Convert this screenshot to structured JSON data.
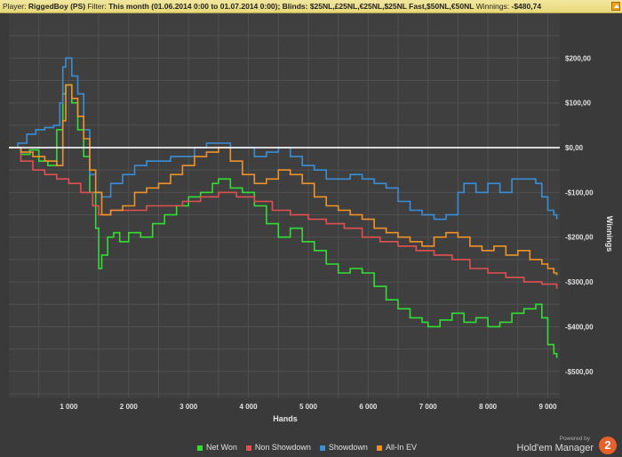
{
  "header": {
    "player_label": "Player:",
    "player_value": "RiggedBoy (PS)",
    "filter_label": "Filter:",
    "filter_value": "This month (01.06.2014 0:00 to 01.07.2014 0:00); Blinds: $25NL,£25NL,€25NL,$25NL Fast,$50NL,€50NL",
    "winnings_label": "Winnings:",
    "winnings_value": "-$480,74"
  },
  "branding": {
    "powered_by": "Powered by",
    "product": "Hold'em Manager",
    "logo_digit": "2",
    "logo_color": "#e8612c"
  },
  "chart_data": {
    "type": "line",
    "xlabel": "Hands",
    "ylabel": "Winnings",
    "xlim": [
      0,
      9200
    ],
    "ylim": [
      -560,
      300
    ],
    "x_ticks": [
      1000,
      2000,
      3000,
      4000,
      5000,
      6000,
      7000,
      8000,
      9000
    ],
    "x_tick_labels": [
      "1 000",
      "2 000",
      "3 000",
      "4 000",
      "5 000",
      "6 000",
      "7 000",
      "8 000",
      "9 000"
    ],
    "y_ticks": [
      200,
      100,
      0,
      -100,
      -200,
      -300,
      -400,
      -500
    ],
    "y_tick_labels": [
      "$200,00",
      "$100,00",
      "$0,00",
      "-$100,00",
      "-$200,00",
      "-$300,00",
      "-$400,00",
      "-$500,00"
    ],
    "zero_line": 0,
    "grid": true,
    "legend_position": "bottom",
    "series": [
      {
        "name": "Net Won",
        "color": "#33dd33",
        "x": [
          0,
          200,
          350,
          500,
          650,
          800,
          900,
          950,
          1050,
          1150,
          1250,
          1350,
          1450,
          1500,
          1550,
          1650,
          1750,
          1850,
          2000,
          2200,
          2400,
          2600,
          2800,
          3000,
          3200,
          3400,
          3500,
          3700,
          3900,
          4100,
          4300,
          4500,
          4700,
          4900,
          5100,
          5300,
          5500,
          5700,
          5900,
          6100,
          6300,
          6500,
          6700,
          6900,
          7000,
          7200,
          7400,
          7600,
          7800,
          8000,
          8200,
          8400,
          8600,
          8800,
          8900,
          9000,
          9100,
          9150
        ],
        "y": [
          0,
          -15,
          -5,
          -30,
          -40,
          40,
          120,
          140,
          100,
          40,
          -20,
          -100,
          -180,
          -270,
          -240,
          -200,
          -190,
          -210,
          -190,
          -200,
          -170,
          -150,
          -130,
          -110,
          -100,
          -80,
          -70,
          -90,
          -100,
          -130,
          -170,
          -200,
          -180,
          -210,
          -230,
          -260,
          -280,
          -270,
          -280,
          -310,
          -340,
          -360,
          -380,
          -390,
          -400,
          -385,
          -370,
          -390,
          -380,
          -400,
          -390,
          -370,
          -360,
          -350,
          -380,
          -440,
          -460,
          -470
        ]
      },
      {
        "name": "Non Showdown",
        "color": "#e05050",
        "x": [
          0,
          200,
          400,
          600,
          800,
          1000,
          1200,
          1400,
          1500,
          1700,
          2000,
          2300,
          2600,
          2900,
          3200,
          3500,
          3800,
          4100,
          4400,
          4700,
          5000,
          5300,
          5600,
          5900,
          6200,
          6500,
          6800,
          7100,
          7400,
          7700,
          8000,
          8300,
          8600,
          8900,
          9150
        ],
        "y": [
          0,
          -30,
          -50,
          -60,
          -70,
          -80,
          -100,
          -130,
          -150,
          -140,
          -140,
          -130,
          -130,
          -120,
          -110,
          -100,
          -110,
          -120,
          -140,
          -150,
          -160,
          -170,
          -180,
          -200,
          -210,
          -220,
          -230,
          -240,
          -250,
          -270,
          -280,
          -290,
          -300,
          -305,
          -315
        ]
      },
      {
        "name": "Showdown",
        "color": "#3a8ed8",
        "x": [
          0,
          150,
          300,
          450,
          600,
          750,
          850,
          900,
          950,
          1050,
          1150,
          1250,
          1350,
          1450,
          1550,
          1700,
          1900,
          2100,
          2300,
          2500,
          2700,
          2900,
          3100,
          3300,
          3500,
          3700,
          3900,
          4100,
          4300,
          4500,
          4700,
          4900,
          5100,
          5300,
          5500,
          5700,
          5900,
          6100,
          6300,
          6500,
          6700,
          6900,
          7100,
          7300,
          7500,
          7600,
          7800,
          8000,
          8200,
          8400,
          8600,
          8800,
          8900,
          9000,
          9100,
          9150
        ],
        "y": [
          0,
          10,
          30,
          40,
          45,
          50,
          100,
          180,
          200,
          160,
          120,
          40,
          -60,
          -100,
          -110,
          -80,
          -60,
          -40,
          -30,
          -30,
          -20,
          -20,
          0,
          10,
          10,
          0,
          0,
          -20,
          -10,
          0,
          -20,
          -40,
          -50,
          -70,
          -70,
          -60,
          -70,
          -80,
          -90,
          -120,
          -140,
          -150,
          -160,
          -150,
          -100,
          -80,
          -100,
          -80,
          -100,
          -70,
          -70,
          -80,
          -110,
          -140,
          -150,
          -160
        ]
      },
      {
        "name": "All-In EV",
        "color": "#f0922a",
        "x": [
          0,
          200,
          400,
          600,
          800,
          900,
          950,
          1050,
          1150,
          1250,
          1350,
          1450,
          1550,
          1700,
          1900,
          2100,
          2300,
          2500,
          2700,
          2900,
          3100,
          3300,
          3500,
          3700,
          3900,
          4100,
          4300,
          4500,
          4700,
          4900,
          5100,
          5300,
          5500,
          5700,
          5900,
          6100,
          6300,
          6500,
          6700,
          6900,
          7100,
          7300,
          7500,
          7700,
          7900,
          8100,
          8300,
          8500,
          8700,
          8900,
          9000,
          9100,
          9150
        ],
        "y": [
          0,
          -10,
          -20,
          -30,
          -40,
          60,
          140,
          110,
          70,
          20,
          -50,
          -100,
          -150,
          -140,
          -130,
          -100,
          -90,
          -80,
          -60,
          -40,
          -20,
          -10,
          0,
          -30,
          -60,
          -80,
          -70,
          -50,
          -60,
          -80,
          -110,
          -130,
          -140,
          -150,
          -160,
          -180,
          -190,
          -200,
          -210,
          -220,
          -200,
          -190,
          -200,
          -220,
          -230,
          -220,
          -240,
          -230,
          -250,
          -260,
          -270,
          -280,
          -285
        ]
      }
    ]
  }
}
